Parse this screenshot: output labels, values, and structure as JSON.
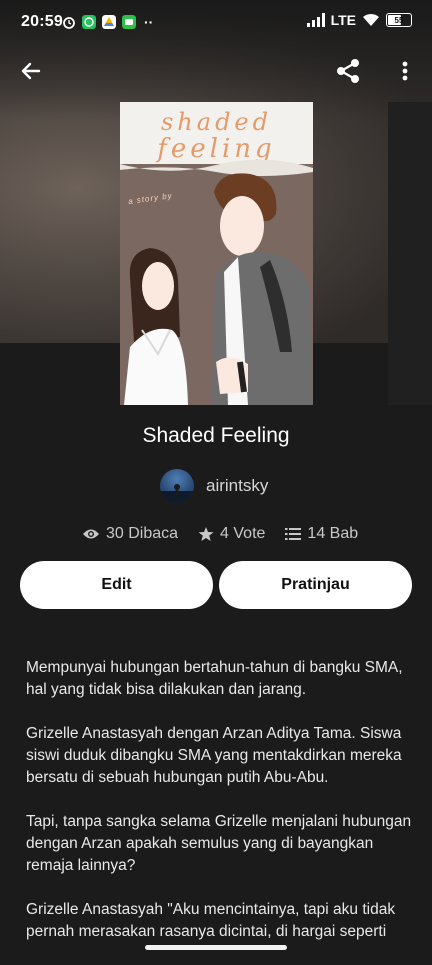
{
  "status_bar": {
    "time": "20:59",
    "network": "LTE",
    "battery": "55"
  },
  "top_bar": {
    "back_icon": "arrow-left-icon",
    "share_icon": "share-icon",
    "more_icon": "more-vertical-icon"
  },
  "cover": {
    "title_line1": "shaded",
    "title_line2": "feeling",
    "story_by": "a story by"
  },
  "book": {
    "title": "Shaded Feeling",
    "author": "airintsky",
    "stats": {
      "reads": "30 Dibaca",
      "votes": "4 Vote",
      "parts": "14 Bab"
    }
  },
  "actions": {
    "edit_label": "Edit",
    "preview_label": "Pratinjau"
  },
  "description": [
    "Mempunyai hubungan bertahun-tahun di bangku SMA, hal yang tidak bisa dilakukan dan jarang.",
    "Grizelle Anastasyah dengan Arzan Aditya Tama. Siswa siswi duduk dibangku SMA yang mentakdirkan mereka bersatu di sebuah hubungan putih Abu-Abu.",
    "Tapi, tanpa sangka selama Grizelle menjalani hubungan dengan Arzan apakah semulus yang di bayangkan remaja lainnya?",
    "Grizelle Anastasyah \"Aku mencintainya, tapi aku tidak pernah merasakan rasanya dicintai, di hargai seperti"
  ]
}
